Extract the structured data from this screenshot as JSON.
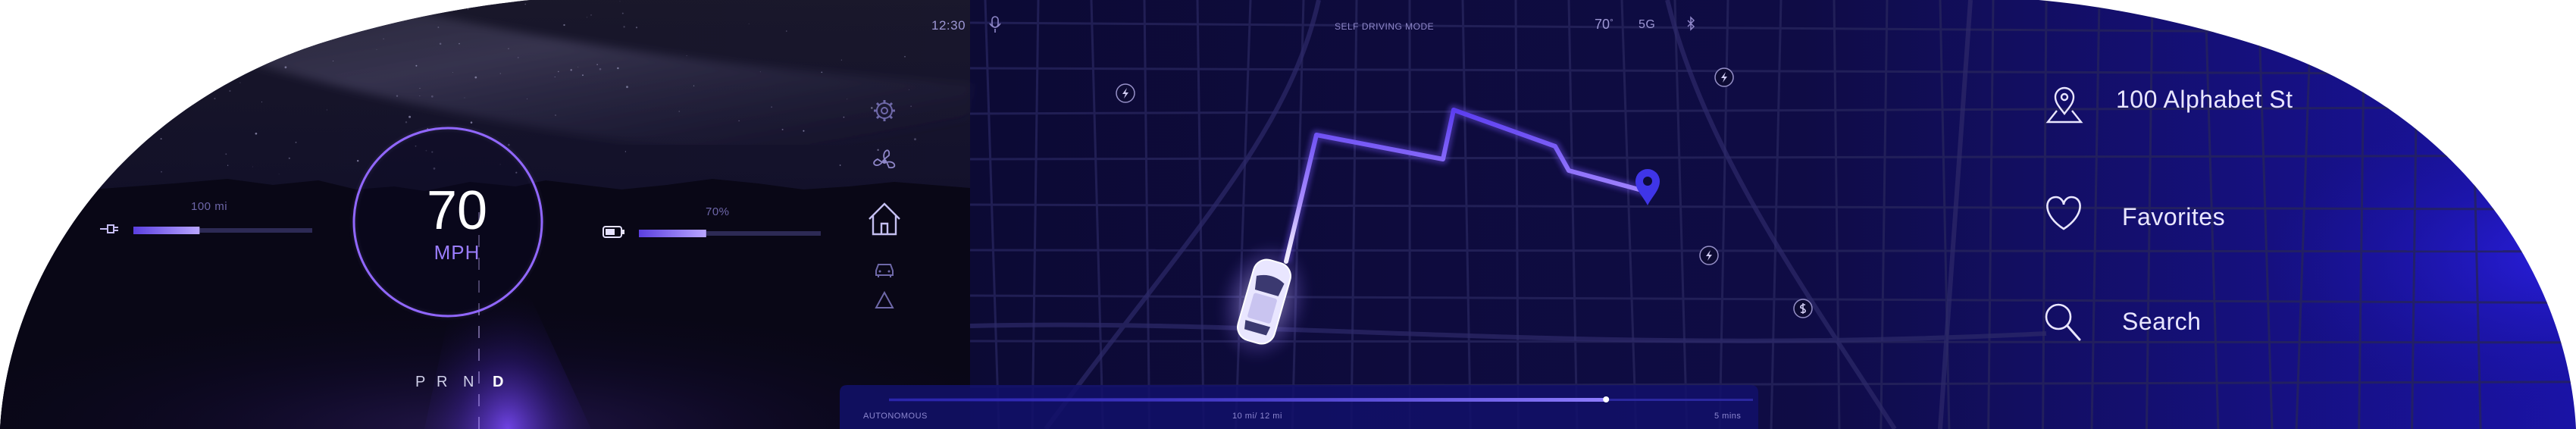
{
  "status_bar": {
    "time": "12:30",
    "mode": "SELF DRIVING MODE",
    "temperature": "70",
    "temperature_unit": "°",
    "network": "5G"
  },
  "left_panel": {
    "range_value": "100 mi",
    "range_fraction": 0.37,
    "battery_value": "70%",
    "battery_fraction": 0.37
  },
  "speedometer": {
    "speed": "70",
    "unit": "MPH"
  },
  "gears": {
    "items": [
      "P",
      "R",
      "N",
      "D"
    ],
    "active": "D"
  },
  "side_icons": [
    "gear-icon",
    "fan-icon",
    "home-icon",
    "car-icon",
    "hazard-icon"
  ],
  "map": {
    "route_progress_fraction": 0.83
  },
  "trip_bar": {
    "mode": "AUTONOMOUS",
    "distance": "10 mi/ 12 mi",
    "eta": "5 mins",
    "progress_fraction": 0.83
  },
  "quick_menu": {
    "address": "100 Alphabet St",
    "favorites": "Favorites",
    "search": "Search"
  },
  "colors": {
    "accent": "#8b6cff",
    "background": "#0d0b3a",
    "route": "#7c5cff",
    "pin": "#4a3aff"
  }
}
